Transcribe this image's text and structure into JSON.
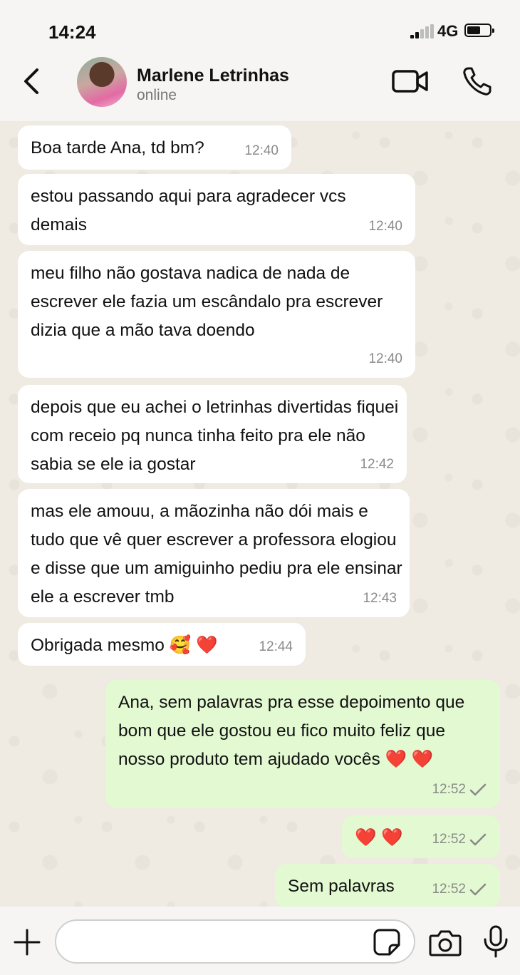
{
  "status_bar": {
    "time": "14:24",
    "network": "4G"
  },
  "header": {
    "contact_name": "Marlene Letrinhas",
    "contact_status": "online",
    "icons": {
      "back": "chevron-left-icon",
      "avatar": "avatar",
      "video": "video-call-icon",
      "phone": "phone-call-icon"
    }
  },
  "messages": [
    {
      "direction": "in",
      "text": "Boa tarde Ana, td bm?",
      "time": "12:40"
    },
    {
      "direction": "in",
      "text": "estou passando aqui para agradecer vcs demais",
      "time": "12:40"
    },
    {
      "direction": "in",
      "text": "meu filho não gostava nadica de nada de escrever ele fazia um escândalo pra escrever dizia que a mão tava doendo",
      "time": "12:40"
    },
    {
      "direction": "in",
      "text": "depois que eu achei o letrinhas divertidas fiquei com receio pq nunca tinha feito pra ele não sabia se ele ia gostar",
      "time": "12:42"
    },
    {
      "direction": "in",
      "text": "mas ele amouu, a mãozinha não dói mais e tudo que vê quer escrever a professora elogiou e disse que um amiguinho pediu pra ele ensinar ele a escrever tmb",
      "time": "12:43"
    },
    {
      "direction": "in",
      "text": "Obrigada mesmo 🥰 ❤️",
      "time": "12:44"
    },
    {
      "direction": "out",
      "text": "Ana, sem palavras pra esse depoimento que bom que ele gostou eu fico muito feliz que nosso produto tem ajudado vocês ❤️ ❤️",
      "time": "12:52",
      "status": "sent"
    },
    {
      "direction": "out",
      "text": "❤️ ❤️",
      "time": "12:52",
      "status": "sent"
    },
    {
      "direction": "out",
      "text": "Sem palavras",
      "time": "12:52",
      "status": "sent"
    }
  ],
  "composer": {
    "placeholder": "",
    "icons": {
      "attach": "plus-icon",
      "sticker": "sticker-icon",
      "camera": "camera-icon",
      "mic": "microphone-icon"
    }
  },
  "colors": {
    "incoming_bubble": "#ffffff",
    "outgoing_bubble": "#e2f9d2",
    "chat_background": "#efeae2",
    "chrome": "#f6f5f3"
  }
}
